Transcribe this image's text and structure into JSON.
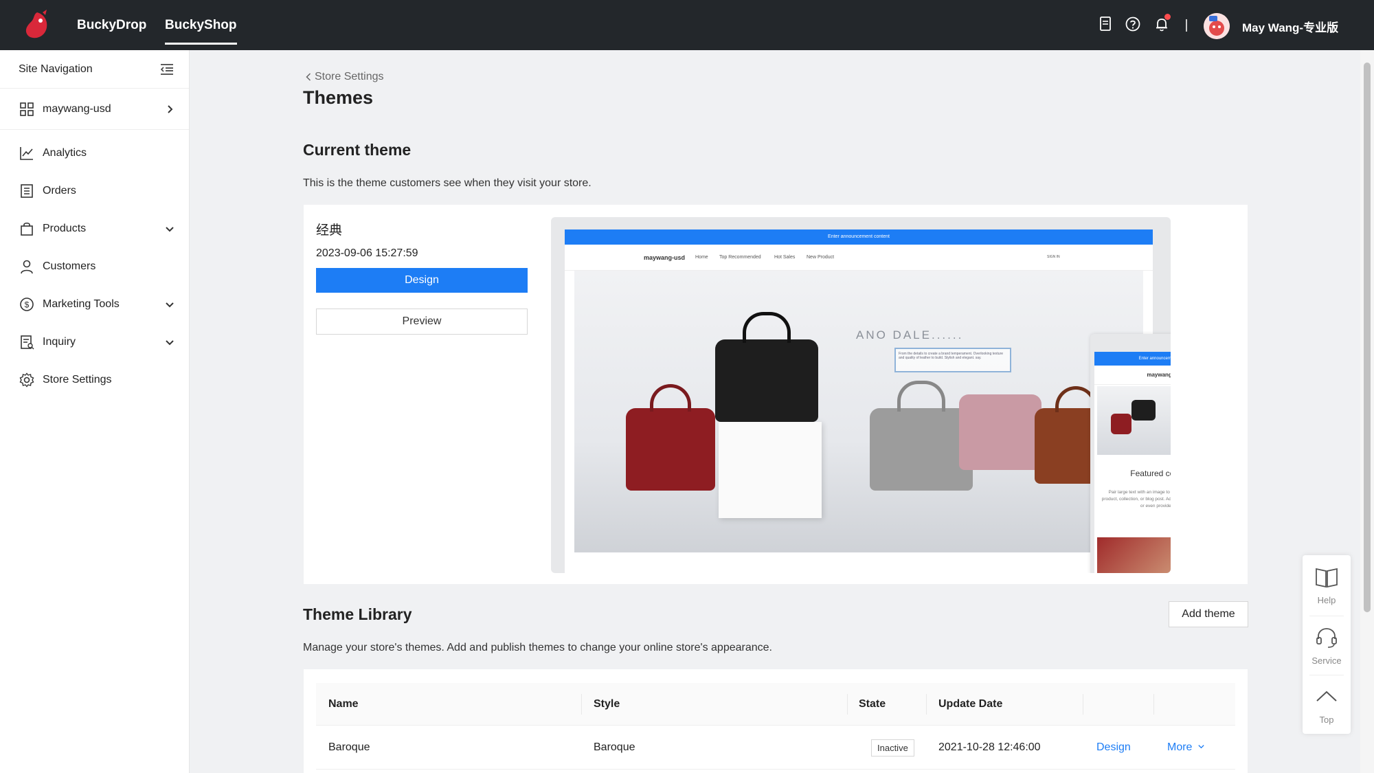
{
  "topbar": {
    "tabs": [
      {
        "label": "BuckyDrop",
        "active": false
      },
      {
        "label": "BuckyShop",
        "active": true
      }
    ],
    "user_name": "May Wang-专业版"
  },
  "sidebar": {
    "header": "Site Navigation",
    "store": "maywang-usd",
    "items": [
      {
        "label": "Analytics",
        "icon": "chart-line-icon",
        "expandable": false
      },
      {
        "label": "Orders",
        "icon": "list-icon",
        "expandable": false
      },
      {
        "label": "Products",
        "icon": "bag-icon",
        "expandable": true
      },
      {
        "label": "Customers",
        "icon": "user-icon",
        "expandable": false
      },
      {
        "label": "Marketing Tools",
        "icon": "dollar-icon",
        "expandable": true
      },
      {
        "label": "Inquiry",
        "icon": "document-icon",
        "expandable": true
      },
      {
        "label": "Store Settings",
        "icon": "gear-icon",
        "expandable": false
      }
    ]
  },
  "main": {
    "breadcrumb": "Store Settings",
    "title": "Themes",
    "current_theme": {
      "heading": "Current theme",
      "description": "This is the theme customers see when they visit your store.",
      "name": "经典",
      "date": "2023-09-06 15:27:59",
      "design_label": "Design",
      "preview_label": "Preview",
      "mock": {
        "announcement": "Enter announcement content",
        "store_name": "maywang-usd",
        "nav_links": [
          "Home",
          "Top Recommended",
          "Hot Sales",
          "New Product"
        ],
        "sign_in": "SIGN IN",
        "hero_text": "ANO DALE......",
        "hero_subtext": "From the details to create a brand temperament. Overlooking texture and quality of leather to build. Stylish and elegant. say.",
        "featured_title": "Featured collection",
        "featured_desc": "Pair large text with an image to give focus to your chosen product, collection, or blog post. Add details on availability, style, or even provide a review."
      }
    },
    "library": {
      "heading": "Theme Library",
      "description": "Manage your store's themes. Add and publish themes to change your online store's appearance.",
      "add_label": "Add theme",
      "columns": [
        "Name",
        "Style",
        "State",
        "Update Date"
      ],
      "rows": [
        {
          "name": "Baroque",
          "style": "Baroque",
          "state": "Inactive",
          "date": "2021-10-28 12:46:00",
          "design": "Design",
          "more": "More"
        }
      ]
    }
  },
  "float_panel": {
    "help": "Help",
    "service": "Service",
    "top": "Top"
  },
  "colors": {
    "topbar": "#23272b",
    "primary": "#1d7df5",
    "background": "#f0f1f3"
  }
}
